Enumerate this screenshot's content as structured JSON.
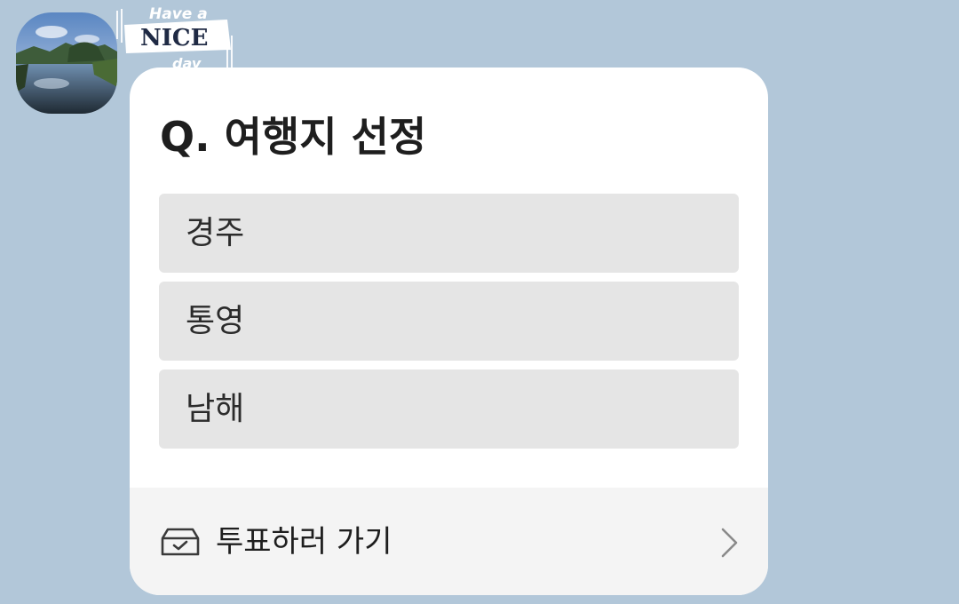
{
  "sender": {
    "avatar_icon": "landscape-photo-avatar",
    "name_sticker_text": [
      "Have a",
      "NICE",
      "day"
    ]
  },
  "poll": {
    "title": "Q. 여행지 선정",
    "options": [
      {
        "label": "경주"
      },
      {
        "label": "통영"
      },
      {
        "label": "남해"
      }
    ],
    "footer": {
      "icon": "ballot-box-icon",
      "label": "투표하러 가기",
      "chevron_icon": "chevron-right-icon"
    }
  },
  "colors": {
    "background": "#b2c7d9",
    "card": "#ffffff",
    "option": "#e5e5e5",
    "footer": "#f4f4f4"
  }
}
